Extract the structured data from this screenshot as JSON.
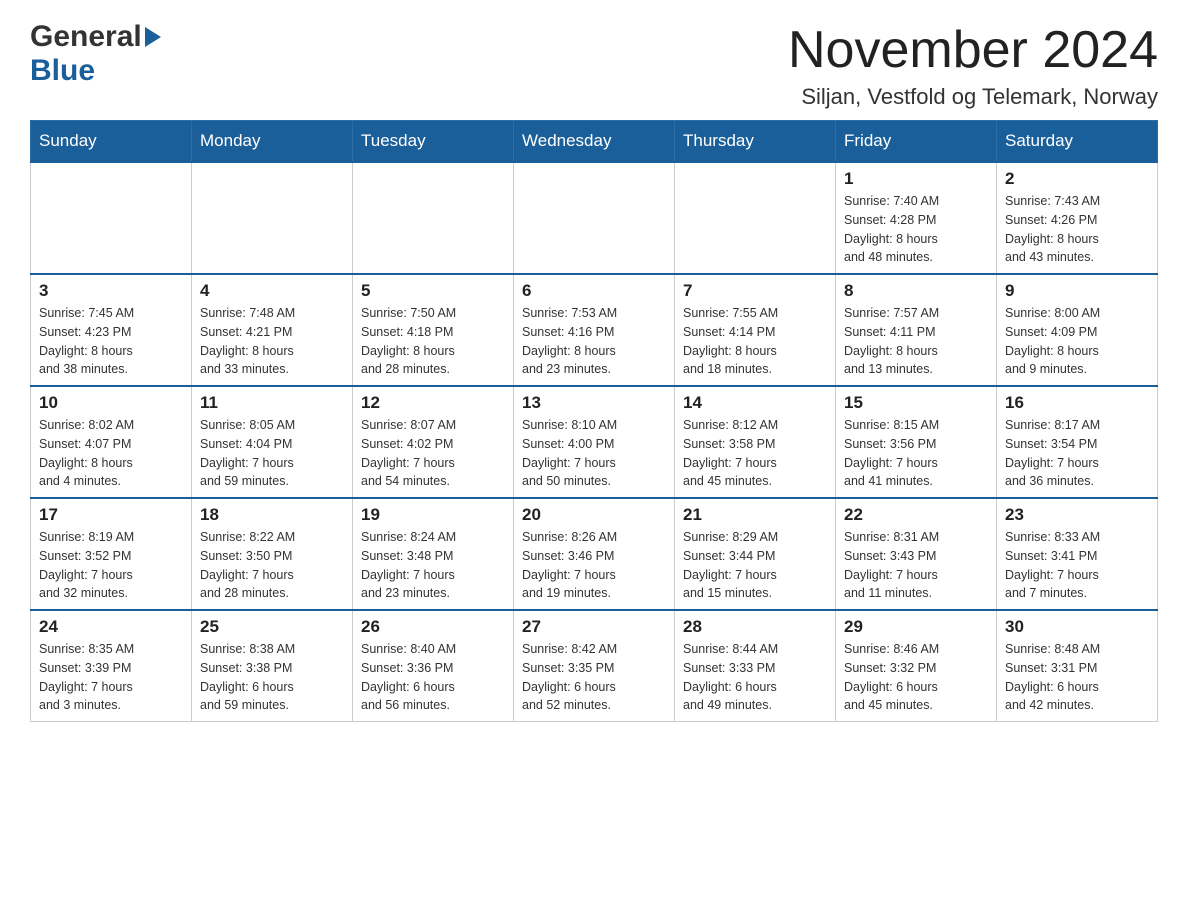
{
  "header": {
    "logo_general": "General",
    "logo_blue": "Blue",
    "main_title": "November 2024",
    "subtitle": "Siljan, Vestfold og Telemark, Norway"
  },
  "weekdays": [
    "Sunday",
    "Monday",
    "Tuesday",
    "Wednesday",
    "Thursday",
    "Friday",
    "Saturday"
  ],
  "weeks": [
    [
      {
        "day": "",
        "info": ""
      },
      {
        "day": "",
        "info": ""
      },
      {
        "day": "",
        "info": ""
      },
      {
        "day": "",
        "info": ""
      },
      {
        "day": "",
        "info": ""
      },
      {
        "day": "1",
        "info": "Sunrise: 7:40 AM\nSunset: 4:28 PM\nDaylight: 8 hours\nand 48 minutes."
      },
      {
        "day": "2",
        "info": "Sunrise: 7:43 AM\nSunset: 4:26 PM\nDaylight: 8 hours\nand 43 minutes."
      }
    ],
    [
      {
        "day": "3",
        "info": "Sunrise: 7:45 AM\nSunset: 4:23 PM\nDaylight: 8 hours\nand 38 minutes."
      },
      {
        "day": "4",
        "info": "Sunrise: 7:48 AM\nSunset: 4:21 PM\nDaylight: 8 hours\nand 33 minutes."
      },
      {
        "day": "5",
        "info": "Sunrise: 7:50 AM\nSunset: 4:18 PM\nDaylight: 8 hours\nand 28 minutes."
      },
      {
        "day": "6",
        "info": "Sunrise: 7:53 AM\nSunset: 4:16 PM\nDaylight: 8 hours\nand 23 minutes."
      },
      {
        "day": "7",
        "info": "Sunrise: 7:55 AM\nSunset: 4:14 PM\nDaylight: 8 hours\nand 18 minutes."
      },
      {
        "day": "8",
        "info": "Sunrise: 7:57 AM\nSunset: 4:11 PM\nDaylight: 8 hours\nand 13 minutes."
      },
      {
        "day": "9",
        "info": "Sunrise: 8:00 AM\nSunset: 4:09 PM\nDaylight: 8 hours\nand 9 minutes."
      }
    ],
    [
      {
        "day": "10",
        "info": "Sunrise: 8:02 AM\nSunset: 4:07 PM\nDaylight: 8 hours\nand 4 minutes."
      },
      {
        "day": "11",
        "info": "Sunrise: 8:05 AM\nSunset: 4:04 PM\nDaylight: 7 hours\nand 59 minutes."
      },
      {
        "day": "12",
        "info": "Sunrise: 8:07 AM\nSunset: 4:02 PM\nDaylight: 7 hours\nand 54 minutes."
      },
      {
        "day": "13",
        "info": "Sunrise: 8:10 AM\nSunset: 4:00 PM\nDaylight: 7 hours\nand 50 minutes."
      },
      {
        "day": "14",
        "info": "Sunrise: 8:12 AM\nSunset: 3:58 PM\nDaylight: 7 hours\nand 45 minutes."
      },
      {
        "day": "15",
        "info": "Sunrise: 8:15 AM\nSunset: 3:56 PM\nDaylight: 7 hours\nand 41 minutes."
      },
      {
        "day": "16",
        "info": "Sunrise: 8:17 AM\nSunset: 3:54 PM\nDaylight: 7 hours\nand 36 minutes."
      }
    ],
    [
      {
        "day": "17",
        "info": "Sunrise: 8:19 AM\nSunset: 3:52 PM\nDaylight: 7 hours\nand 32 minutes."
      },
      {
        "day": "18",
        "info": "Sunrise: 8:22 AM\nSunset: 3:50 PM\nDaylight: 7 hours\nand 28 minutes."
      },
      {
        "day": "19",
        "info": "Sunrise: 8:24 AM\nSunset: 3:48 PM\nDaylight: 7 hours\nand 23 minutes."
      },
      {
        "day": "20",
        "info": "Sunrise: 8:26 AM\nSunset: 3:46 PM\nDaylight: 7 hours\nand 19 minutes."
      },
      {
        "day": "21",
        "info": "Sunrise: 8:29 AM\nSunset: 3:44 PM\nDaylight: 7 hours\nand 15 minutes."
      },
      {
        "day": "22",
        "info": "Sunrise: 8:31 AM\nSunset: 3:43 PM\nDaylight: 7 hours\nand 11 minutes."
      },
      {
        "day": "23",
        "info": "Sunrise: 8:33 AM\nSunset: 3:41 PM\nDaylight: 7 hours\nand 7 minutes."
      }
    ],
    [
      {
        "day": "24",
        "info": "Sunrise: 8:35 AM\nSunset: 3:39 PM\nDaylight: 7 hours\nand 3 minutes."
      },
      {
        "day": "25",
        "info": "Sunrise: 8:38 AM\nSunset: 3:38 PM\nDaylight: 6 hours\nand 59 minutes."
      },
      {
        "day": "26",
        "info": "Sunrise: 8:40 AM\nSunset: 3:36 PM\nDaylight: 6 hours\nand 56 minutes."
      },
      {
        "day": "27",
        "info": "Sunrise: 8:42 AM\nSunset: 3:35 PM\nDaylight: 6 hours\nand 52 minutes."
      },
      {
        "day": "28",
        "info": "Sunrise: 8:44 AM\nSunset: 3:33 PM\nDaylight: 6 hours\nand 49 minutes."
      },
      {
        "day": "29",
        "info": "Sunrise: 8:46 AM\nSunset: 3:32 PM\nDaylight: 6 hours\nand 45 minutes."
      },
      {
        "day": "30",
        "info": "Sunrise: 8:48 AM\nSunset: 3:31 PM\nDaylight: 6 hours\nand 42 minutes."
      }
    ]
  ]
}
